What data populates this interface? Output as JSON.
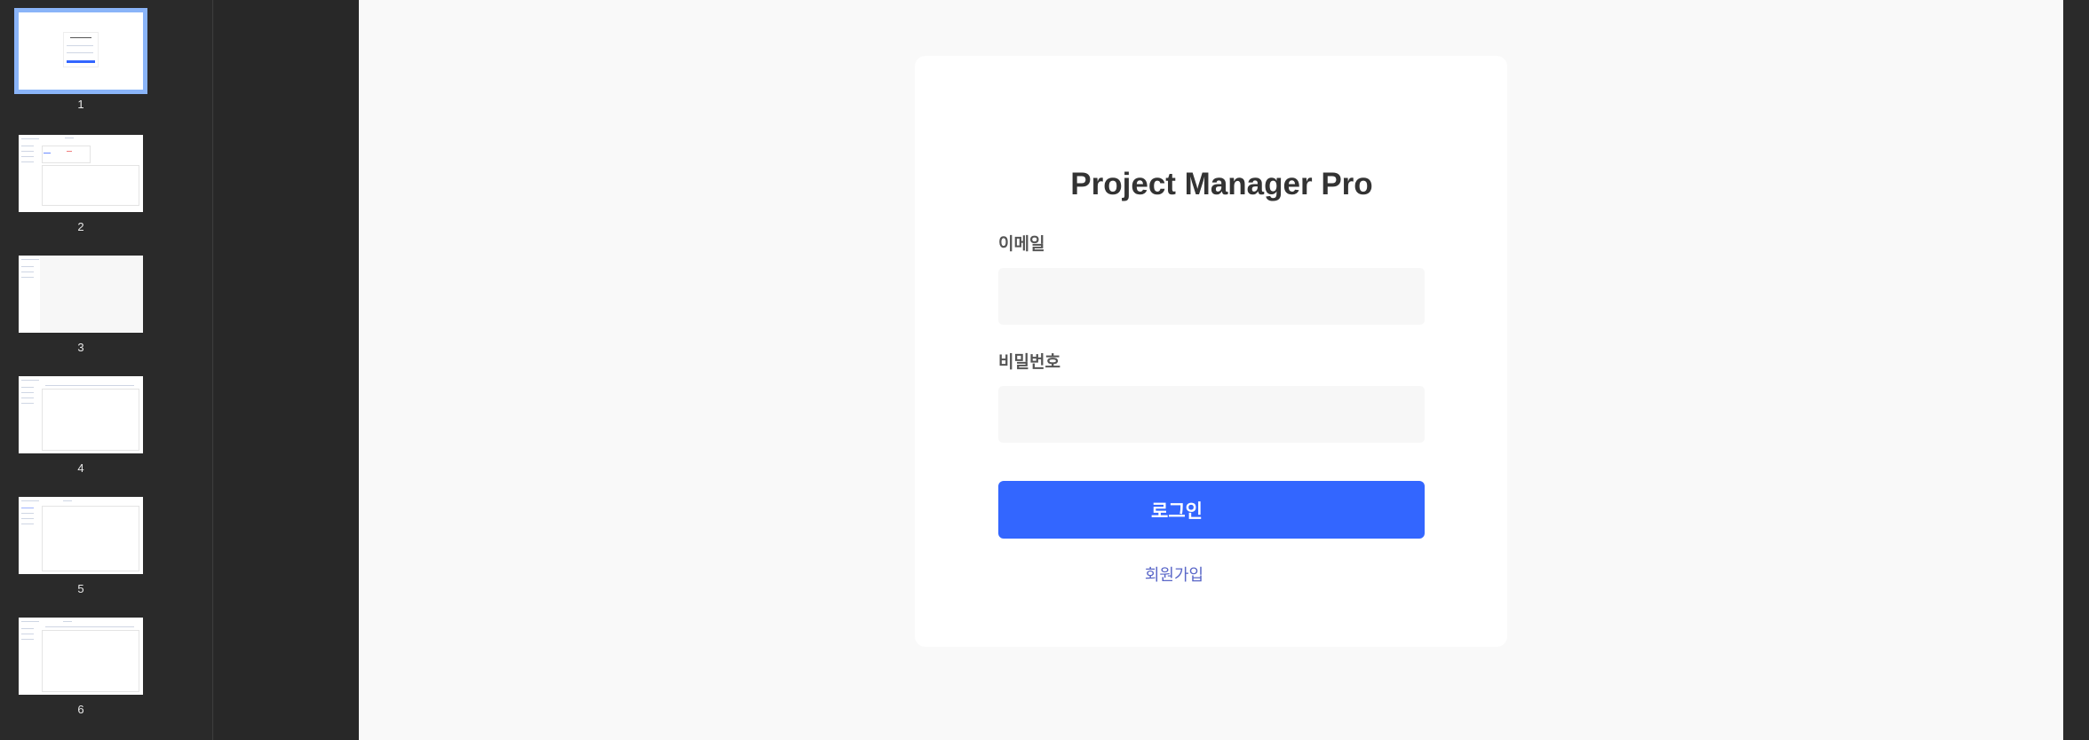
{
  "thumbnails": [
    {
      "page": "1",
      "selected": true
    },
    {
      "page": "2",
      "selected": false
    },
    {
      "page": "3",
      "selected": false
    },
    {
      "page": "4",
      "selected": false
    },
    {
      "page": "5",
      "selected": false
    },
    {
      "page": "6",
      "selected": false
    }
  ],
  "login": {
    "title": "Project Manager Pro",
    "email_label": "이메일",
    "email_value": "",
    "password_label": "비밀번호",
    "password_value": "",
    "login_button": "로그인",
    "signup_link": "회원가입"
  },
  "colors": {
    "accent": "#3366ff",
    "link": "#5a67c8",
    "selection": "#8ab4f8"
  }
}
